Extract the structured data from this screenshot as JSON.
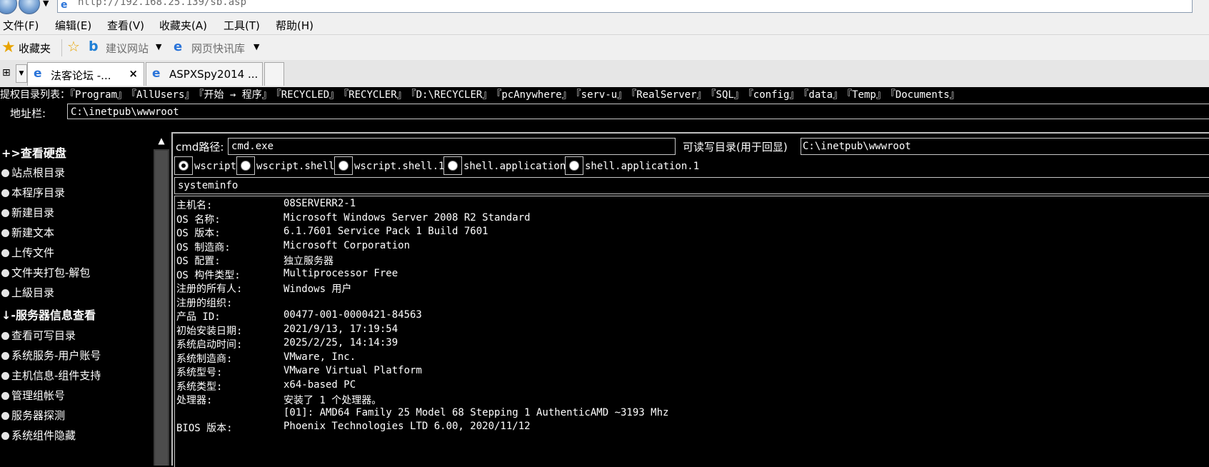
{
  "browser": {
    "address": "http://192.168.25.139/sb.asp",
    "menu": [
      "文件(F)",
      "编辑(E)",
      "查看(V)",
      "收藏夹(A)",
      "工具(T)",
      "帮助(H)"
    ],
    "favorites_label": "收藏夹",
    "fav_links": [
      "建议网站",
      "网页快讯库"
    ],
    "tabs": [
      {
        "label": "法客论坛 -..."
      },
      {
        "label": "ASPXSpy2014 ..."
      }
    ]
  },
  "dirbar": {
    "prefix": "提权目录列表：",
    "items": [
      "『Program』",
      "『AllUsers』",
      "『开始 → 程序』",
      "『RECYCLED』",
      "『RECYCLER』",
      "『D:\\RECYCLER』",
      "『pcAnywhere』",
      "『serv-u』",
      "『RealServer』",
      "『SQL』",
      "『config』",
      "『data』",
      "『Temp』",
      "『Documents』"
    ]
  },
  "addressrow": {
    "label": "地址栏:",
    "value": "C:\\inetpub\\wwwroot"
  },
  "sidebar": {
    "header1": "+>查看硬盘",
    "items1": [
      "站点根目录",
      "本程序目录",
      "新建目录",
      "新建文本",
      "上传文件",
      "文件夹打包-解包",
      "上級目录"
    ],
    "header2": "↓-服务器信息查看",
    "items2": [
      "查看可写目录",
      "系统服务-用户账号",
      "主机信息-组件支持",
      "管理组帐号",
      "服务器探测",
      "系统组件隐藏"
    ]
  },
  "cmd": {
    "path_label": "cmd路径:",
    "path_value": "cmd.exe",
    "rw_label": "可读写目录(用于回显)",
    "rw_value": "C:\\inetpub\\wwwroot",
    "options": [
      "wscript",
      "wscript.shell",
      "wscript.shell.1",
      "shell.application",
      "shell.application.1"
    ],
    "selected": "wscript",
    "command": "systeminfo"
  },
  "output": [
    {
      "k": "主机名:",
      "v": "08SERVERR2-1"
    },
    {
      "k": "OS 名称:",
      "v": "Microsoft Windows Server 2008 R2 Standard"
    },
    {
      "k": "OS 版本:",
      "v": "6.1.7601 Service Pack 1 Build 7601"
    },
    {
      "k": "OS 制造商:",
      "v": "Microsoft Corporation"
    },
    {
      "k": "OS 配置:",
      "v": "独立服务器"
    },
    {
      "k": "OS 构件类型:",
      "v": "Multiprocessor Free"
    },
    {
      "k": "注册的所有人:",
      "v": "Windows 用户"
    },
    {
      "k": "注册的组织:",
      "v": ""
    },
    {
      "k": "产品 ID:",
      "v": "00477-001-0000421-84563"
    },
    {
      "k": "初始安装日期:",
      "v": "2021/9/13, 17:19:54"
    },
    {
      "k": "系统启动时间:",
      "v": "2025/2/25, 14:14:39"
    },
    {
      "k": "系统制造商:",
      "v": "VMware, Inc."
    },
    {
      "k": "系统型号:",
      "v": "VMware Virtual Platform"
    },
    {
      "k": "系统类型:",
      "v": "x64-based PC"
    },
    {
      "k": "处理器:",
      "v": "安装了 1 个处理器。"
    },
    {
      "k": "",
      "v": "[01]: AMD64 Family 25 Model 68 Stepping 1 AuthenticAMD ~3193 Mhz"
    },
    {
      "k": "BIOS 版本:",
      "v": "Phoenix Technologies LTD 6.00, 2020/11/12"
    }
  ]
}
